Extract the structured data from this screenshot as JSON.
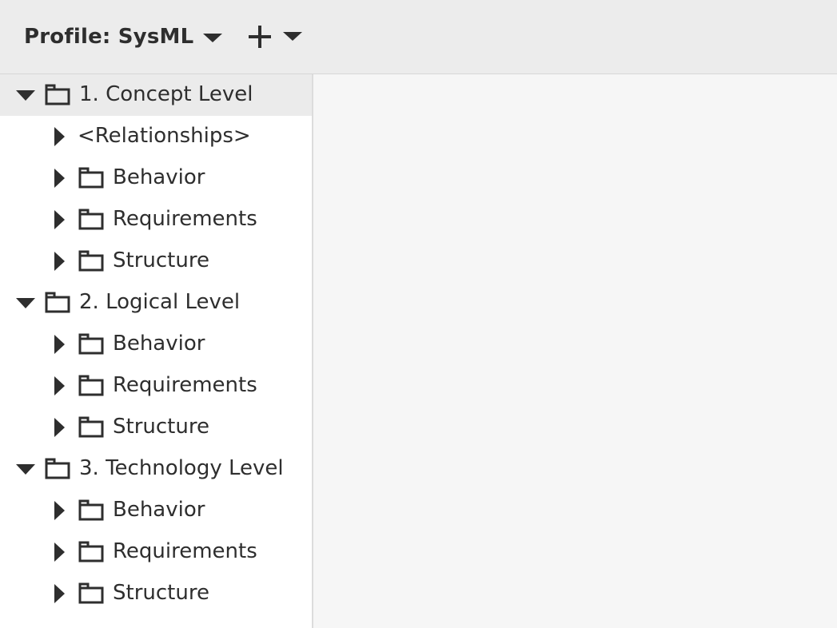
{
  "toolbar": {
    "profile_label": "Profile: SysML",
    "profile_dropdown_icon": "caret-down-icon",
    "add_icon": "plus-icon",
    "add_dropdown_icon": "caret-down-icon"
  },
  "tree": {
    "items": [
      {
        "label": "1. Concept Level",
        "level": 0,
        "expanded": true,
        "folder": true,
        "selected": true
      },
      {
        "label": "<Relationships>",
        "level": 1,
        "expanded": false,
        "folder": false
      },
      {
        "label": "Behavior",
        "level": 1,
        "expanded": false,
        "folder": true
      },
      {
        "label": "Requirements",
        "level": 1,
        "expanded": false,
        "folder": true
      },
      {
        "label": "Structure",
        "level": 1,
        "expanded": false,
        "folder": true
      },
      {
        "label": "2. Logical Level",
        "level": 0,
        "expanded": true,
        "folder": true
      },
      {
        "label": "Behavior",
        "level": 1,
        "expanded": false,
        "folder": true
      },
      {
        "label": "Requirements",
        "level": 1,
        "expanded": false,
        "folder": true
      },
      {
        "label": "Structure",
        "level": 1,
        "expanded": false,
        "folder": true
      },
      {
        "label": "3. Technology Level",
        "level": 0,
        "expanded": true,
        "folder": true
      },
      {
        "label": "Behavior",
        "level": 1,
        "expanded": false,
        "folder": true
      },
      {
        "label": "Requirements",
        "level": 1,
        "expanded": false,
        "folder": true
      },
      {
        "label": "Structure",
        "level": 1,
        "expanded": false,
        "folder": true
      }
    ]
  },
  "colors": {
    "toolbar_bg": "#ececec",
    "selected_row_bg": "#ebebeb",
    "text": "#2e2e2e",
    "content_bg": "#f6f6f6"
  }
}
